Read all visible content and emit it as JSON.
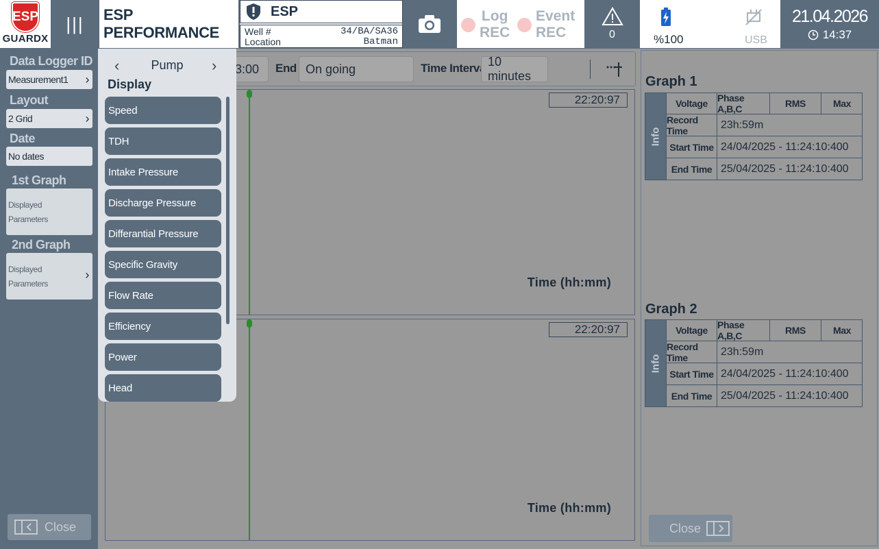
{
  "header": {
    "logo_top": "ESP",
    "logo_bottom": "GUARDX",
    "app_title": "ESP PERFORMANCE",
    "device_name": "ESP",
    "well_label": "Well #",
    "well_value": "34/BA/SA36",
    "location_label": "Location",
    "location_value": "Batman",
    "log_rec": [
      "Log",
      "REC"
    ],
    "event_rec": [
      "Event",
      "REC"
    ],
    "warning_count": "0",
    "battery_text": "%100",
    "usb_text": "USB",
    "date": "21.04.2026",
    "time": "14:37"
  },
  "sidebar": {
    "data_logger_label": "Data Logger ID",
    "data_logger_value": "Measurement1",
    "layout_label": "Layout",
    "layout_value": "2 Grid",
    "date_label": "Date",
    "date_value": "No dates",
    "graph1_label": "1st Graph",
    "graph2_label": "2nd Graph",
    "params_text": [
      "Displayed",
      "Parameters"
    ],
    "close_label": "Close"
  },
  "toolbar": {
    "start_partial": "3:00",
    "end_label": "End",
    "end_value": "On going",
    "interval_label": "Time Interval",
    "interval_value": "10 minutes"
  },
  "graphs": [
    {
      "time": "22:20:97",
      "xlabel": "Time (hh:mm)"
    },
    {
      "time": "22:20:97",
      "xlabel": "Time (hh:mm)"
    }
  ],
  "dropdown": {
    "title": "Pump",
    "heading": "Display",
    "items": [
      "Speed",
      "TDH",
      "Intake Pressure",
      "Discharge Pressure",
      "Differantial Pressure",
      "Specific Gravity",
      "Flow Rate",
      "Efficiency",
      "Power",
      "Head"
    ]
  },
  "right_panel": {
    "info_label": "Info",
    "close_label": "Close",
    "graphs": [
      {
        "title": "Graph 1",
        "cols": [
          "Voltage",
          "Phase A,B,C",
          "RMS",
          "Max"
        ],
        "rows": [
          {
            "label": "Record Time",
            "value": "23h:59m"
          },
          {
            "label": "Start Time",
            "value": "24/04/2025 - 11:24:10:400"
          },
          {
            "label": "End Time",
            "value": "25/04/2025 - 11:24:10:400"
          }
        ]
      },
      {
        "title": "Graph 2",
        "cols": [
          "Voltage",
          "Phase A,B,C",
          "RMS",
          "Max"
        ],
        "rows": [
          {
            "label": "Record Time",
            "value": "23h:59m"
          },
          {
            "label": "Start Time",
            "value": "24/04/2025 - 11:24:10:400"
          },
          {
            "label": "End Time",
            "value": "25/04/2025 - 11:24:10:400"
          }
        ]
      }
    ]
  },
  "colors": {
    "header_bg": "#5b6c7d",
    "logo_red": "#d92626",
    "graph_line": "#2a8c2a"
  }
}
